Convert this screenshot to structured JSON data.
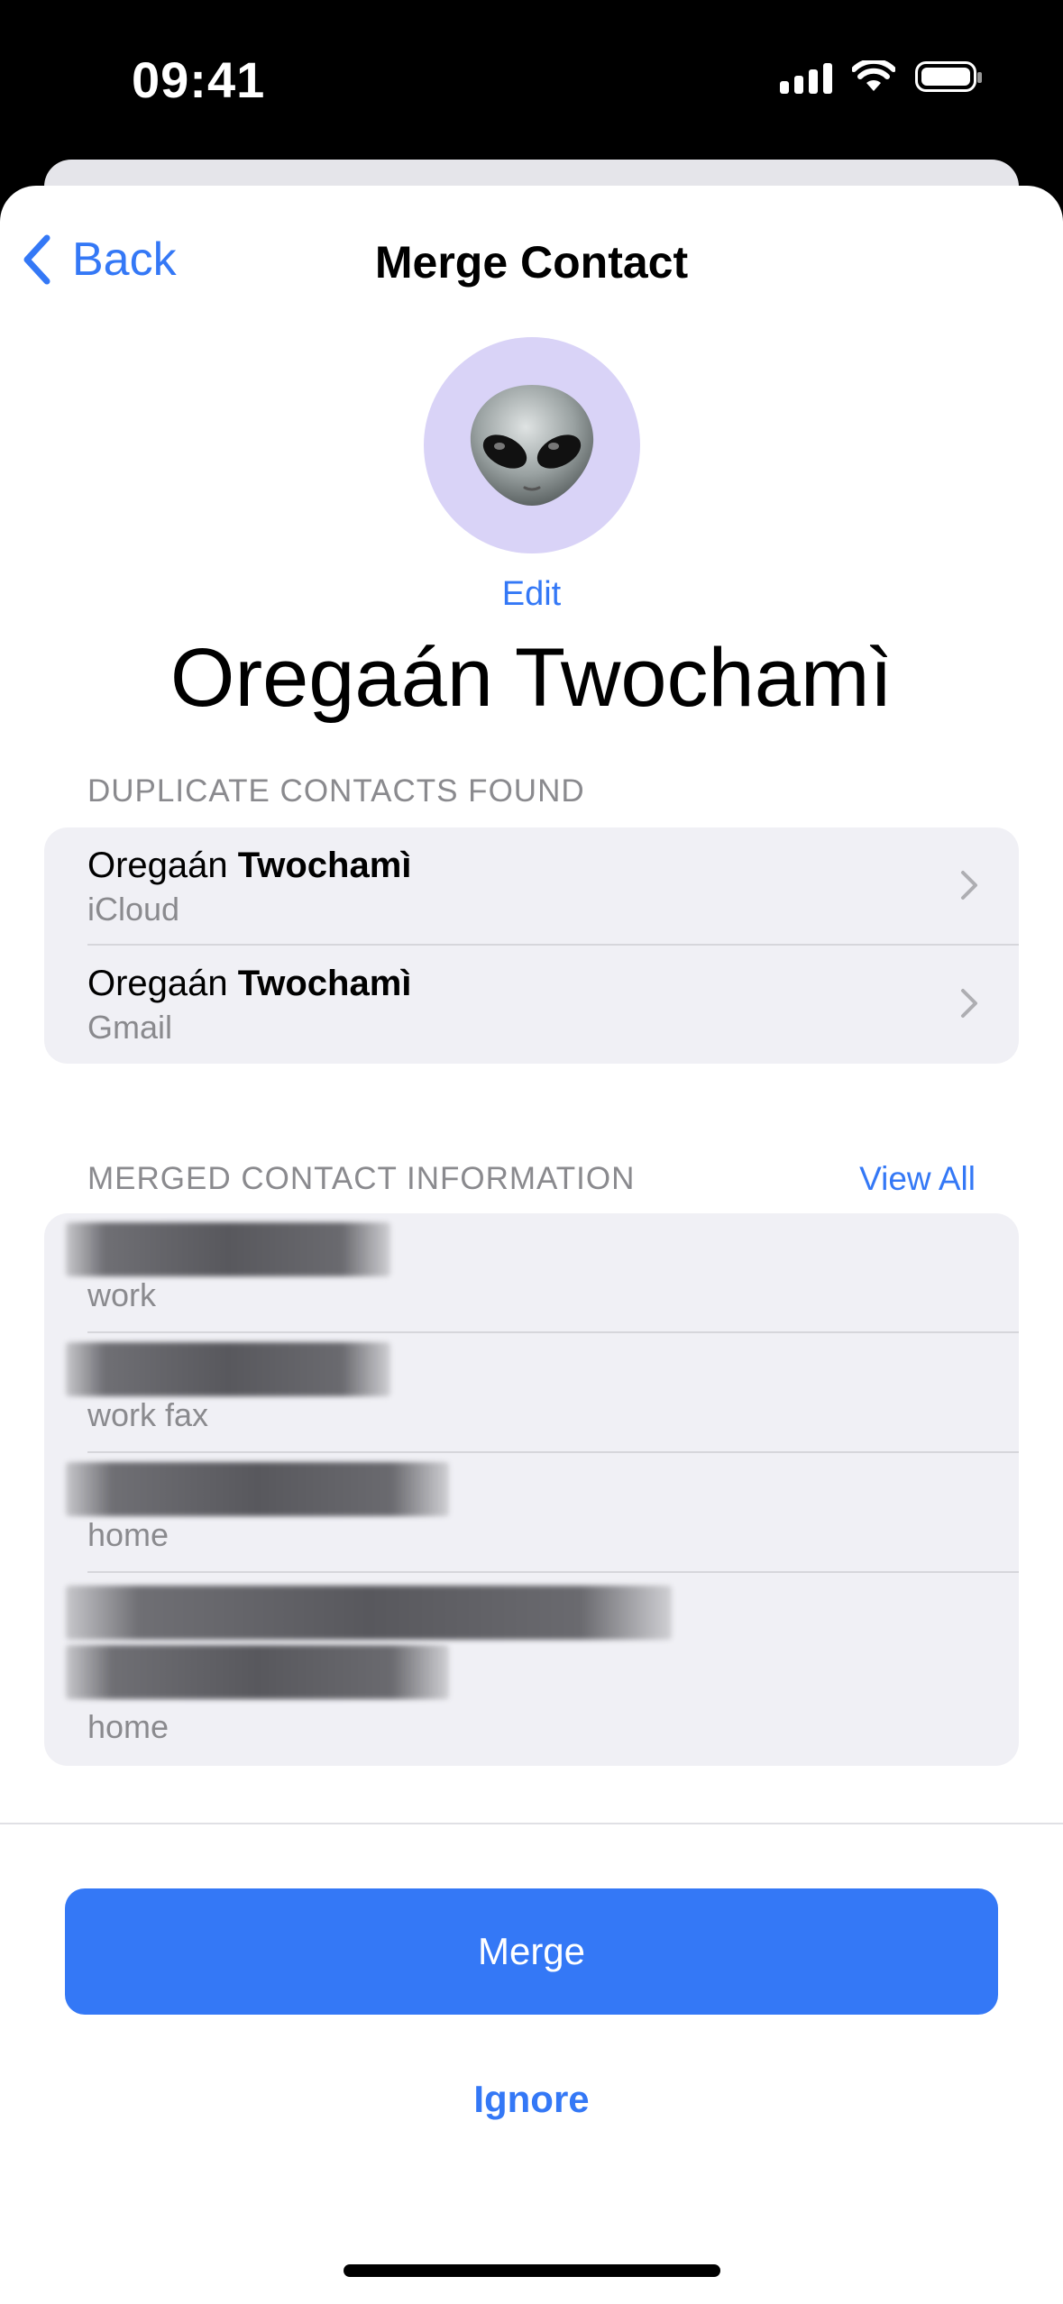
{
  "status_bar": {
    "time": "09:41"
  },
  "nav": {
    "back_label": "Back",
    "title": "Merge Contact"
  },
  "contact": {
    "edit_label": "Edit",
    "name": "Oregaán Twochamì",
    "avatar_icon": "alien-memoji-icon"
  },
  "duplicates": {
    "header": "DUPLICATE CONTACTS FOUND",
    "items": [
      {
        "first": "Oregaán",
        "last": "Twochamì",
        "source": "iCloud"
      },
      {
        "first": "Oregaán",
        "last": "Twochamì",
        "source": "Gmail"
      }
    ]
  },
  "merged": {
    "header": "MERGED CONTACT INFORMATION",
    "view_all_label": "View All",
    "items": [
      {
        "label": "work"
      },
      {
        "label": "work fax"
      },
      {
        "label": "home"
      },
      {
        "label": "home"
      }
    ]
  },
  "actions": {
    "merge_label": "Merge",
    "ignore_label": "Ignore"
  },
  "colors": {
    "accent": "#3478f6",
    "group_bg": "#f0f0f5",
    "secondary_text": "#8a8a8e"
  }
}
